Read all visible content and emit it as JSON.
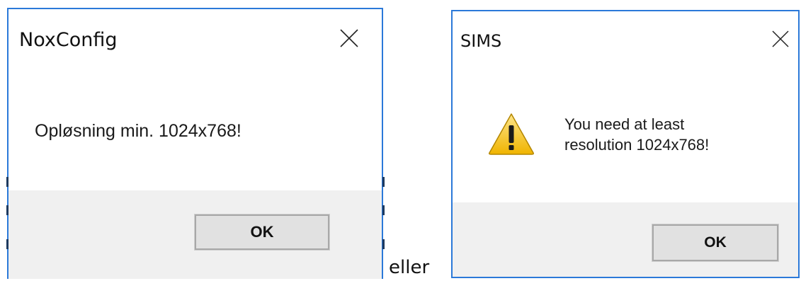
{
  "dialog1": {
    "title": "NoxConfig",
    "message": "Opløsning min. 1024x768!",
    "ok_label": "OK"
  },
  "separator_text": "eller",
  "dialog2": {
    "title": "SIMS",
    "message_line1": "You need at least",
    "message_line2": "resolution 1024x768!",
    "ok_label": "OK"
  },
  "colors": {
    "window_border": "#2b79d9",
    "footer_bg": "#f0f0f0",
    "button_bg": "#e1e1e1",
    "warning_yellow": "#f5c518"
  }
}
